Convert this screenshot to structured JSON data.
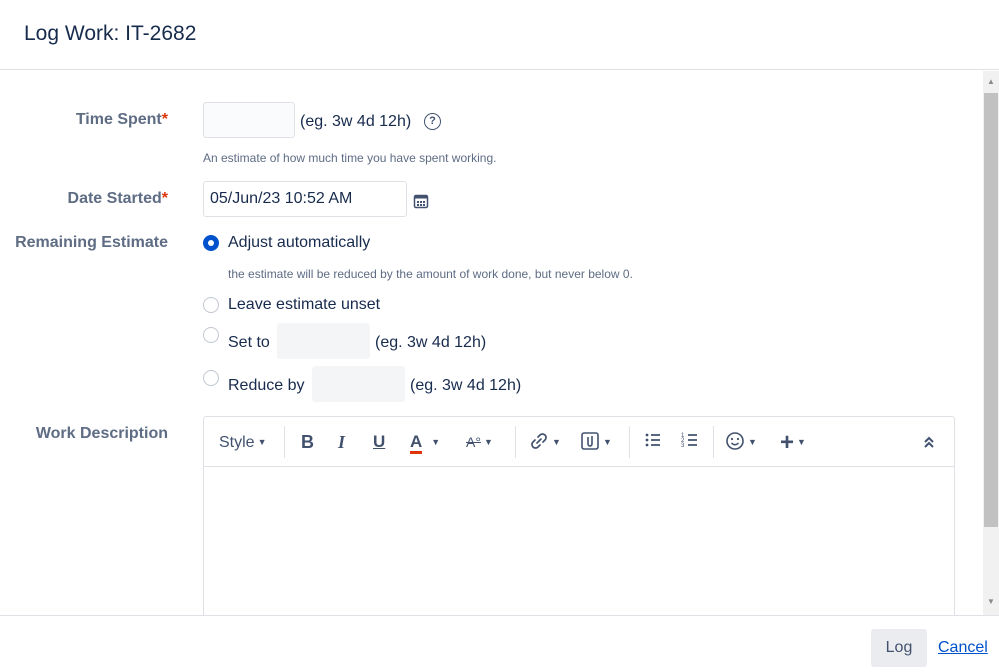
{
  "dialog": {
    "title": "Log Work: IT-2682"
  },
  "time_spent": {
    "label": "Time Spent",
    "required_mark": "*",
    "value": "",
    "example": "(eg. 3w 4d 12h)",
    "help_icon": "question-circle-icon",
    "description": "An estimate of how much time you have spent working."
  },
  "date_started": {
    "label": "Date Started",
    "required_mark": "*",
    "value": "05/Jun/23 10:52 AM",
    "calendar_icon": "calendar-icon"
  },
  "remaining_estimate": {
    "label": "Remaining Estimate",
    "options": [
      {
        "label": "Adjust automatically",
        "checked": true,
        "note": "the estimate will be reduced by the amount of work done, but never below 0."
      },
      {
        "label": "Leave estimate unset",
        "checked": false
      },
      {
        "label": "Set to",
        "checked": false,
        "example": "(eg. 3w 4d 12h)"
      },
      {
        "label": "Reduce by",
        "checked": false,
        "example": "(eg. 3w 4d 12h)"
      }
    ]
  },
  "work_description": {
    "label": "Work Description",
    "toolbar": {
      "style_label": "Style",
      "bold": "B",
      "italic": "I",
      "underline": "U",
      "text_color": "A",
      "more_formatting": "A°",
      "link_icon": "link-icon",
      "attachment_icon": "attachment-icon",
      "bullet_list_icon": "bullet-list-icon",
      "numbered_list_icon": "numbered-list-icon",
      "emoji_icon": "emoji-icon",
      "insert_more": "+",
      "collapse_icon": "double-chevron-up-icon"
    },
    "value": ""
  },
  "footer": {
    "log_label": "Log",
    "cancel_label": "Cancel"
  },
  "colors": {
    "accent": "#0052cc",
    "required": "#de350b",
    "label": "#5e6c84",
    "text_color_underline": "#de350b"
  }
}
